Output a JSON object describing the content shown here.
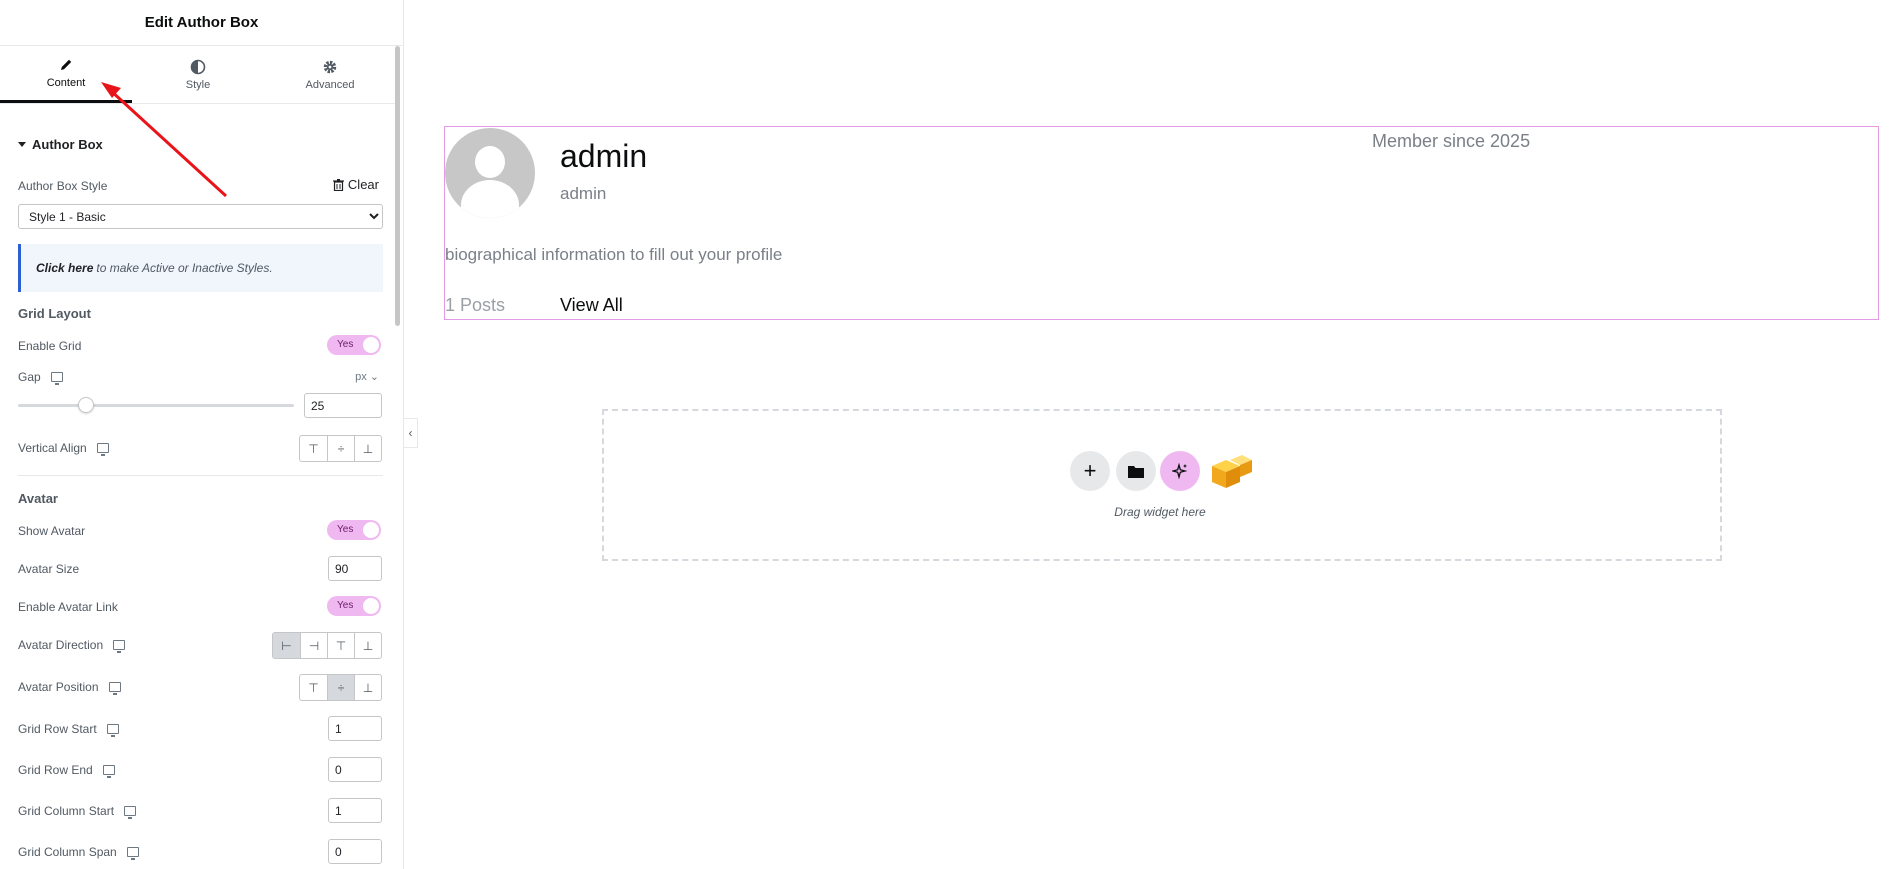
{
  "panel": {
    "title": "Edit Author Box",
    "tabs": [
      {
        "label": "Content",
        "icon": "pencil-icon",
        "active": true
      },
      {
        "label": "Style",
        "icon": "contrast-icon",
        "active": false
      },
      {
        "label": "Advanced",
        "icon": "gear-icon",
        "active": false
      }
    ],
    "section_author_box": "Author Box",
    "author_box_style_label": "Author Box Style",
    "clear_label": "Clear",
    "style_selected": "Style 1 - Basic",
    "notice_link": "Click here",
    "notice_text": "to make Active or Inactive Styles.",
    "grid_layout_heading": "Grid Layout",
    "enable_grid_label": "Enable Grid",
    "enable_grid_value": "Yes",
    "gap_label": "Gap",
    "gap_unit": "px",
    "gap_value": "25",
    "vertical_align_label": "Vertical Align",
    "avatar_heading": "Avatar",
    "show_avatar_label": "Show Avatar",
    "show_avatar_value": "Yes",
    "avatar_size_label": "Avatar Size",
    "avatar_size_value": "90",
    "enable_avatar_link_label": "Enable Avatar Link",
    "enable_avatar_link_value": "Yes",
    "avatar_direction_label": "Avatar Direction",
    "avatar_position_label": "Avatar Position",
    "grid_row_start_label": "Grid Row Start",
    "grid_row_start_value": "1",
    "grid_row_end_label": "Grid Row End",
    "grid_row_end_value": "0",
    "grid_column_start_label": "Grid Column Start",
    "grid_column_start_value": "1",
    "grid_column_span_label": "Grid Column Span",
    "grid_column_span_value": "0"
  },
  "canvas": {
    "author_name": "admin",
    "author_username": "admin",
    "member_since": "Member since 2025",
    "bio": "biographical information to fill out your profile",
    "post_count": "1 Posts",
    "view_all": "View All",
    "drag_text": "Drag widget here"
  },
  "colors": {
    "accent_pink": "#f0b8f0",
    "selection_border": "#e49ae6",
    "notice_border": "#2c5fd1",
    "annotation_arrow": "#e8141a"
  }
}
